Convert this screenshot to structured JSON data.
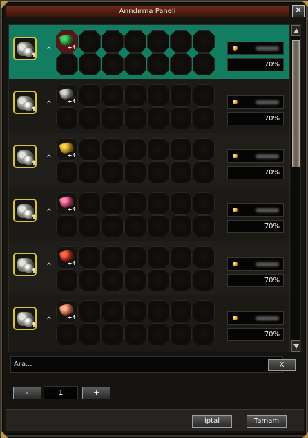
{
  "window": {
    "title": "Arındırma Paneli",
    "close_icon": "close-icon"
  },
  "rows": [
    {
      "selected": true,
      "caret": "^",
      "gem_color": "#1b6e2b",
      "gem_glow": "#48d16b",
      "plus": "+4",
      "hot": true,
      "rate": "70%"
    },
    {
      "selected": false,
      "caret": "^",
      "gem_color": "#5b5d60",
      "gem_glow": "#d7d7d7",
      "plus": "+4",
      "hot": false,
      "rate": "70%"
    },
    {
      "selected": false,
      "caret": "^",
      "gem_color": "#9b7414",
      "gem_glow": "#ffd24a",
      "plus": "+4",
      "hot": false,
      "rate": "70%"
    },
    {
      "selected": false,
      "caret": "^",
      "gem_color": "#a22c55",
      "gem_glow": "#ff8ab7",
      "plus": "+4",
      "hot": false,
      "rate": "70%"
    },
    {
      "selected": false,
      "caret": "^",
      "gem_color": "#8f1f12",
      "gem_glow": "#ff6b46",
      "plus": "+4",
      "hot": false,
      "rate": "70%"
    },
    {
      "selected": false,
      "caret": "^",
      "gem_color": "#a24d36",
      "gem_glow": "#ffb38c",
      "plus": "+4",
      "hot": false,
      "rate": "70%"
    }
  ],
  "search": {
    "placeholder": "Ara...",
    "clear_label": "X"
  },
  "quantity": {
    "minus_label": "-",
    "value": "1",
    "plus_label": "+"
  },
  "actions": {
    "cancel_label": "iptal",
    "ok_label": "Tamam"
  }
}
